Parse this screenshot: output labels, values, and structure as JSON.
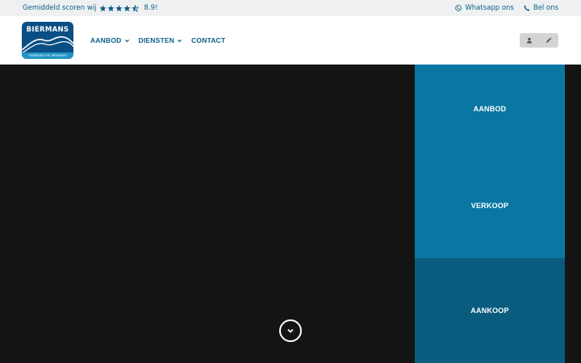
{
  "topbar": {
    "rating_text": "Gemiddeld scoren wij",
    "stars_full": 4,
    "stars_half": 1,
    "score": "8.9!",
    "whatsapp_label": "Whatsapp ons",
    "call_label": "Bel ons"
  },
  "logo": {
    "word": "BIERMANS",
    "tagline": "makelaars en adviseurs"
  },
  "nav": {
    "items": [
      {
        "label": "AANBOD",
        "dropdown": true
      },
      {
        "label": "DIENSTEN",
        "dropdown": true
      },
      {
        "label": "CONTACT",
        "dropdown": false
      }
    ]
  },
  "account": {
    "icons": [
      "user-icon",
      "pencil-icon"
    ]
  },
  "panels": [
    {
      "label": "AANBOD",
      "color": "#0a77a3"
    },
    {
      "label": "VERKOOP",
      "color": "#0a77a3"
    },
    {
      "label": "AANKOOP",
      "color": "#0a5c7e"
    }
  ],
  "colors": {
    "brand": "#0a5e86",
    "hero_bg": "#141414",
    "topbar_bg": "#eef0f1"
  },
  "scroll": {
    "icon": "chevron-down-icon"
  }
}
